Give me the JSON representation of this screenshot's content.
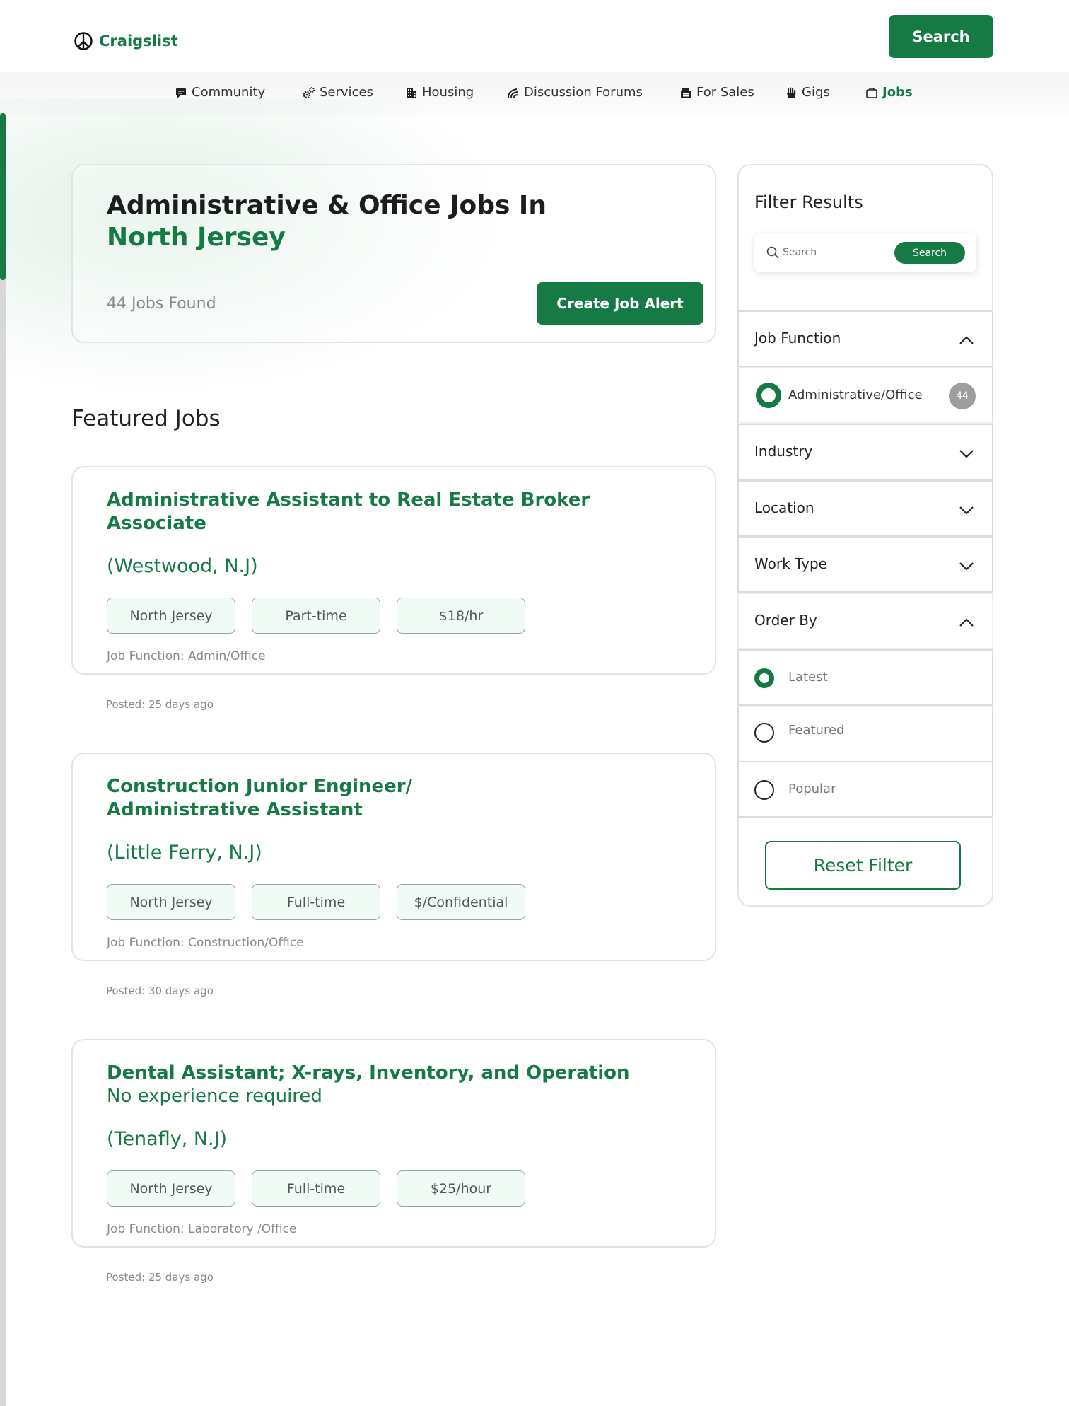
{
  "header": {
    "logo_text": "Craigslist",
    "logo_icon": "peace-icon",
    "search_label": "Search"
  },
  "nav": {
    "items": [
      {
        "label": "Community",
        "icon": "community-icon"
      },
      {
        "label": "Services",
        "icon": "gears-icon"
      },
      {
        "label": "Housing",
        "icon": "building-icon"
      },
      {
        "label": "Discussion Forums",
        "icon": "forums-icon"
      },
      {
        "label": "For Sales",
        "icon": "sale-icon"
      },
      {
        "label": "Gigs",
        "icon": "hand-icon"
      },
      {
        "label": "Jobs",
        "icon": "briefcase-icon"
      }
    ],
    "active": "Jobs"
  },
  "hero": {
    "title": "Administrative & Office Jobs In",
    "subtitle": "North Jersey",
    "count": "44 Jobs Found",
    "alert_button": "Create Job Alert"
  },
  "featured": {
    "title": "Featured Jobs",
    "jobs": [
      {
        "title": "Administrative Assistant to Real Estate Broker Associate",
        "title_extra": "",
        "location": "(Westwood, N.J)",
        "tags": [
          "North Jersey",
          "Part-time",
          "$18/hr"
        ],
        "function": "Job Function: Admin/Office",
        "posted": "Posted: 25 days ago"
      },
      {
        "title": "Construction Junior Engineer/ Administrative Assistant",
        "title_extra": "",
        "location": "(Little Ferry, N.J)",
        "tags": [
          "North Jersey",
          "Full-time",
          "$/Confidential"
        ],
        "function": "Job Function: Construction/Office",
        "posted": "Posted: 30 days ago"
      },
      {
        "title": "Dental Assistant; X-rays, Inventory, and Operation",
        "title_extra": "No experience required",
        "location": "(Tenafly, N.J)",
        "tags": [
          "North Jersey",
          "Full-time",
          "$25/hour"
        ],
        "function": "Job Function: Laboratory /Office",
        "posted": "Posted: 25 days ago"
      }
    ]
  },
  "sidebar": {
    "title": "Filter Results",
    "search_placeholder": "Search",
    "search_button": "Search",
    "job_function": {
      "label": "Job Function",
      "option": "Administrative/Office",
      "count": "44"
    },
    "industry": "Industry",
    "location": "Location",
    "work_type": "Work Type",
    "order_by": {
      "label": "Order By",
      "options": [
        "Latest",
        "Featured",
        "Popular"
      ],
      "selected": "Latest"
    },
    "reset_button": "Reset Filter"
  },
  "colors": {
    "brand": "#157a43",
    "badge": "#9e9e9e",
    "tag_bg": "#f1fbf5"
  }
}
